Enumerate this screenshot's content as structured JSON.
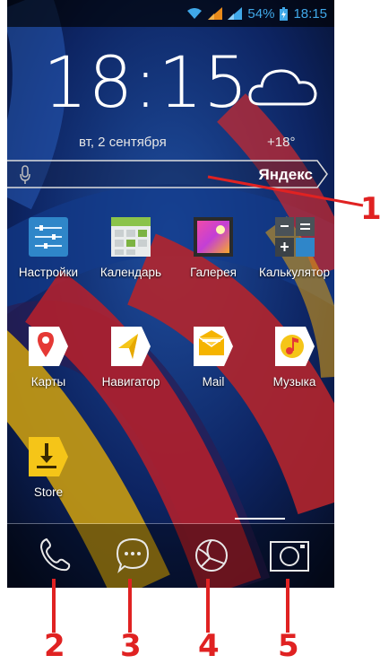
{
  "status_bar": {
    "battery": "54%",
    "time": "18:15"
  },
  "clock_widget": {
    "time": "18:15",
    "date": "вт, 2 сентября"
  },
  "weather": {
    "temperature": "+18°",
    "icon": "cloud-icon"
  },
  "search_bar": {
    "brand": "Яндекс",
    "icon": "microphone-icon"
  },
  "apps": [
    {
      "label": "Настройки",
      "icon": "settings-icon"
    },
    {
      "label": "Календарь",
      "icon": "calendar-icon"
    },
    {
      "label": "Галерея",
      "icon": "gallery-icon"
    },
    {
      "label": "Калькулятор",
      "icon": "calculator-icon"
    },
    {
      "label": "Карты",
      "icon": "maps-icon"
    },
    {
      "label": "Навигатор",
      "icon": "navigator-icon"
    },
    {
      "label": "Mail",
      "icon": "mail-icon"
    },
    {
      "label": "Музыка",
      "icon": "music-icon"
    },
    {
      "label": "Store",
      "icon": "store-icon"
    }
  ],
  "dock": [
    {
      "name": "phone",
      "icon": "phone-icon"
    },
    {
      "name": "messages",
      "icon": "chat-icon"
    },
    {
      "name": "browser",
      "icon": "browser-icon"
    },
    {
      "name": "camera",
      "icon": "camera-icon"
    }
  ],
  "annotations": [
    "1",
    "2",
    "3",
    "4",
    "5"
  ],
  "colors": {
    "annotation": "#e02222",
    "status_icons": "#40a8e8"
  }
}
